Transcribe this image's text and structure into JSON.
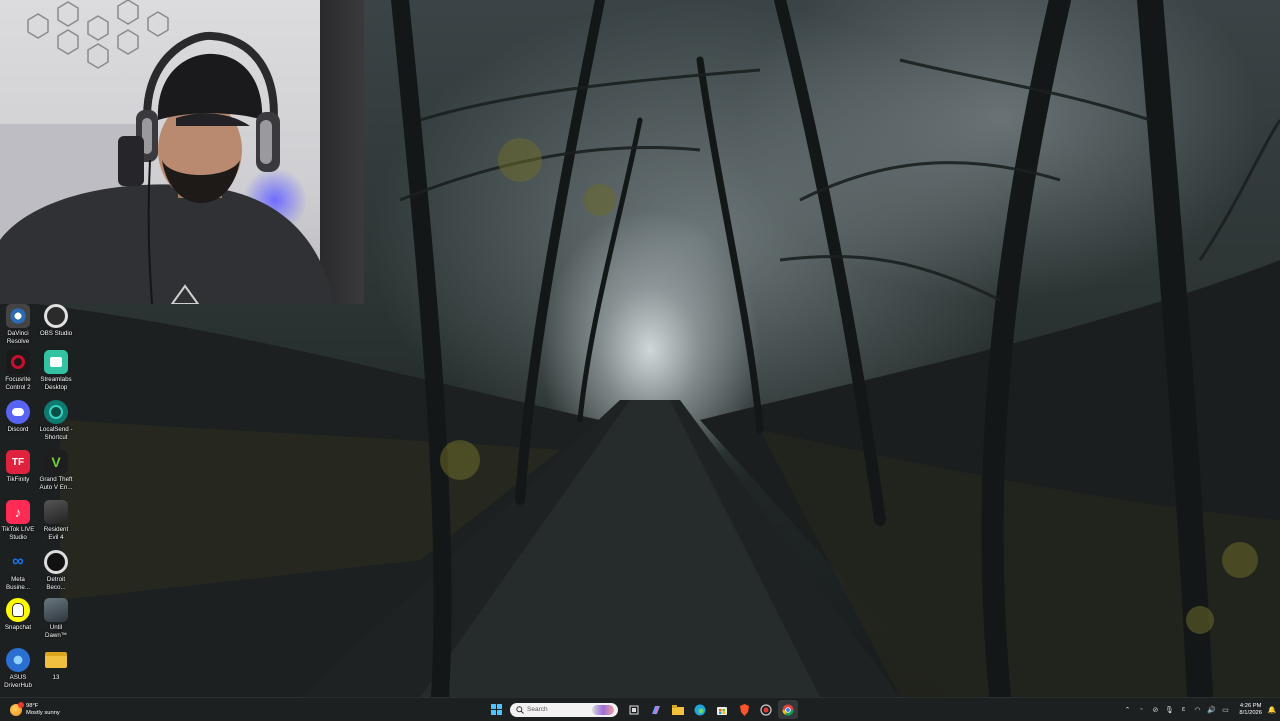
{
  "desktop_icons": [
    {
      "id": "davinci",
      "label": "DaVinci Resolve",
      "icon": "davinci-resolve-icon",
      "color": "#2a6bb3"
    },
    {
      "id": "obs",
      "label": "OBS Studio",
      "icon": "obs-studio-icon",
      "color": "#2b2b2b"
    },
    {
      "id": "focusrite",
      "label": "Focusrite Control 2",
      "icon": "focusrite-icon",
      "color": "#c8102e"
    },
    {
      "id": "streamlabs",
      "label": "Streamlabs Desktop",
      "icon": "streamlabs-icon",
      "color": "#31c3a2"
    },
    {
      "id": "discord",
      "label": "Discord",
      "icon": "discord-icon",
      "color": "#5865f2"
    },
    {
      "id": "localsend",
      "label": "LocalSend - Shortcut",
      "icon": "localsend-icon",
      "color": "#0f7a70"
    },
    {
      "id": "tikfinity",
      "label": "TikFinity",
      "icon": "tikfinity-icon",
      "color": "#e0223f"
    },
    {
      "id": "gta",
      "label": "Grand Theft Auto V En...",
      "icon": "gta-icon",
      "color": "#1e1e1e"
    },
    {
      "id": "tiktok",
      "label": "TikTok LIVE Studio",
      "icon": "tiktok-live-icon",
      "color": "#fe2c55"
    },
    {
      "id": "re4",
      "label": "Resident Evil 4",
      "icon": "resident-evil-icon",
      "color": "#3a3a3a"
    },
    {
      "id": "meta",
      "label": "Meta Busine...",
      "icon": "meta-icon",
      "color": "#0668e1"
    },
    {
      "id": "detroit",
      "label": "Detroit Beco...",
      "icon": "detroit-icon",
      "color": "#111111"
    },
    {
      "id": "snapchat",
      "label": "Snapchat",
      "icon": "snapchat-icon",
      "color": "#fffc00"
    },
    {
      "id": "untildawn",
      "label": "Until Dawn™",
      "icon": "until-dawn-icon",
      "color": "#4a5660"
    },
    {
      "id": "asus",
      "label": "ASUS DriverHub",
      "icon": "asus-driverhub-icon",
      "color": "#2a6fd1"
    },
    {
      "id": "folder13",
      "label": "13",
      "icon": "folder-icon",
      "color": "#f0c040"
    }
  ],
  "taskbar": {
    "weather": {
      "temp": "98°F",
      "condition": "Mostly sunny"
    },
    "search_placeholder": "Search",
    "apps": [
      "start-icon",
      "task-view-icon",
      "copilot-icon",
      "file-explorer-icon",
      "edge-icon",
      "microsoft-store-icon",
      "brave-icon",
      "screen-recorder-icon",
      "chrome-icon"
    ],
    "clock": {
      "time": "4:26 PM",
      "date": "8/1/2026"
    }
  }
}
